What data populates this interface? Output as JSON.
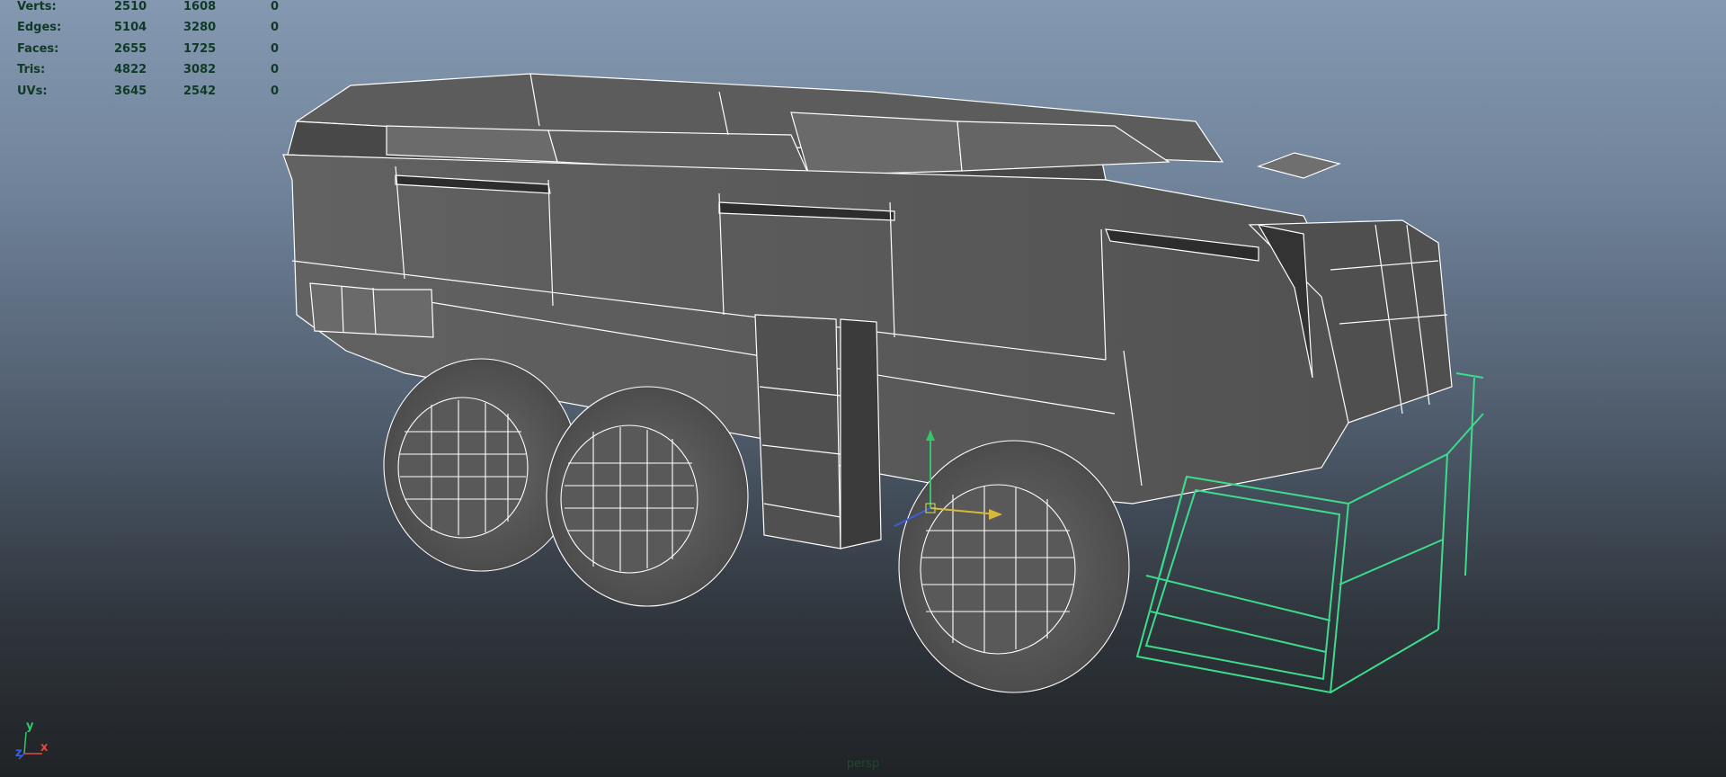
{
  "hud": {
    "rows": [
      {
        "label": "Verts:",
        "v1": "2510",
        "v2": "1608",
        "v3": "0"
      },
      {
        "label": "Edges:",
        "v1": "5104",
        "v2": "3280",
        "v3": "0"
      },
      {
        "label": "Faces:",
        "v1": "2655",
        "v2": "1725",
        "v3": "0"
      },
      {
        "label": "Tris:",
        "v1": "4822",
        "v2": "3082",
        "v3": "0"
      },
      {
        "label": "UVs:",
        "v1": "3645",
        "v2": "2542",
        "v3": "0"
      }
    ]
  },
  "axis": {
    "y": "y",
    "x": "x",
    "z": "z"
  },
  "camera": {
    "name": "persp"
  },
  "colors": {
    "wire": "#ffffff",
    "selection": "#3ddc8c",
    "body": "#5a5a5a",
    "hud_text": "#0f3a26",
    "axis_y": "#34c76a",
    "axis_x": "#e34b3d",
    "axis_z": "#3b5ee0"
  },
  "icons": [
    "move-manipulator-icon",
    "view-axis-icon"
  ]
}
